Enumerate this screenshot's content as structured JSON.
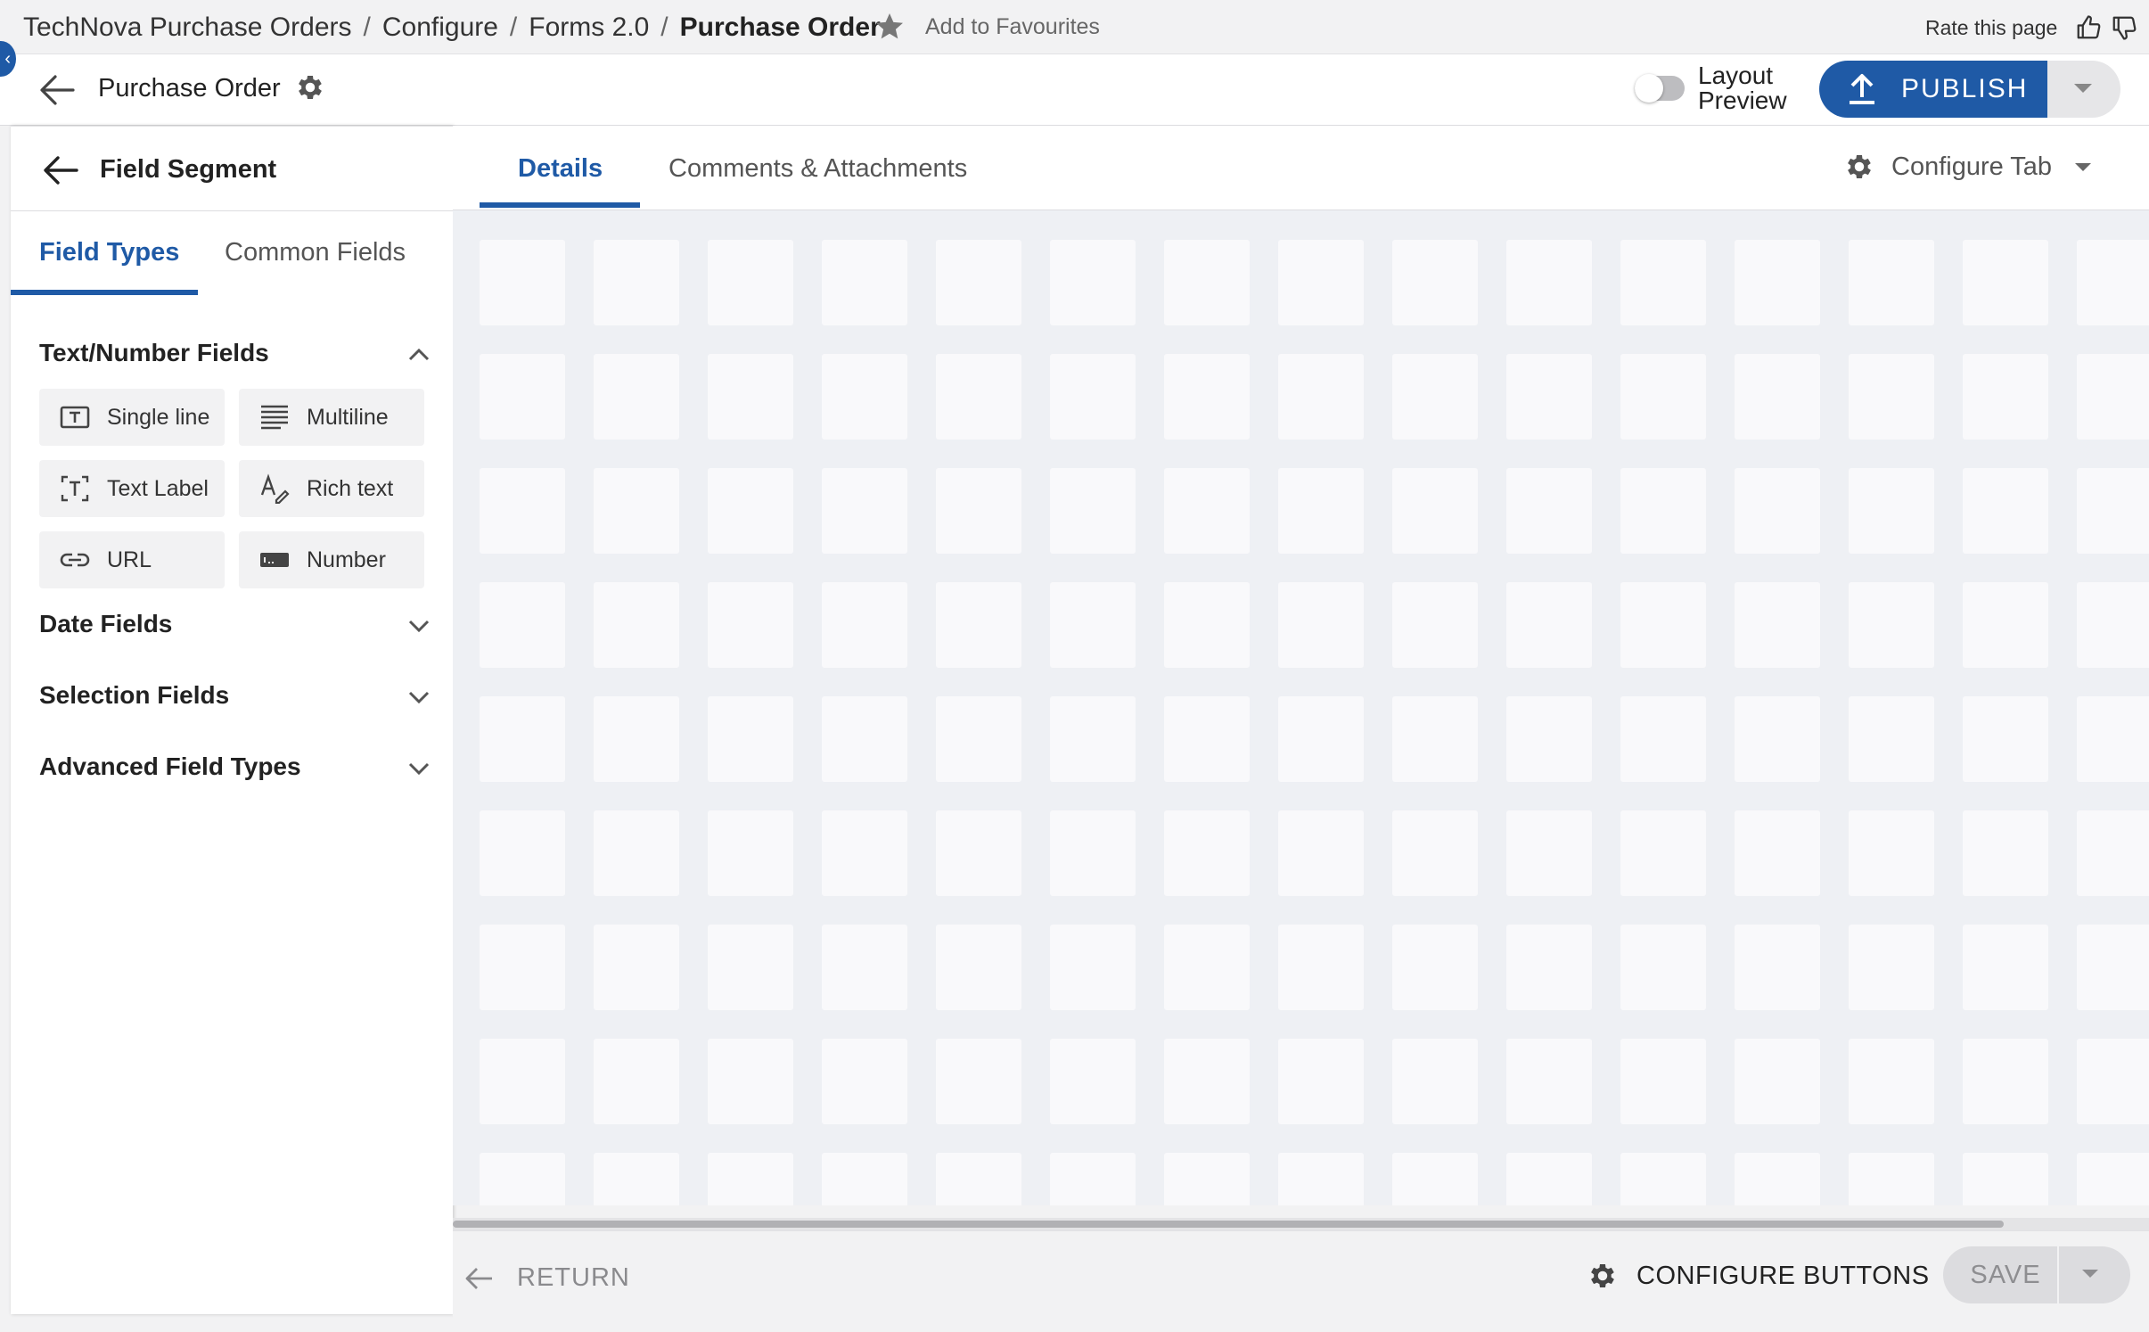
{
  "breadcrumb": {
    "items": [
      "TechNova Purchase Orders",
      "Configure",
      "Forms 2.0"
    ],
    "separator": "/",
    "current": "Purchase Order"
  },
  "favourites": {
    "label": "Add to Favourites",
    "icon": "star-icon"
  },
  "rating": {
    "label": "Rate this page",
    "icons": [
      "thumbs-up-icon",
      "thumbs-down-icon"
    ]
  },
  "header": {
    "title": "Purchase Order",
    "layout_preview": {
      "line1": "Layout",
      "line2": "Preview",
      "on": false
    },
    "publish_label": "PUBLISH"
  },
  "panel": {
    "title": "Field Segment",
    "tabs": [
      {
        "label": "Field Types",
        "active": true
      },
      {
        "label": "Common Fields",
        "active": false
      }
    ],
    "sections": [
      {
        "title": "Text/Number Fields",
        "expanded": true,
        "fields": [
          {
            "label": "Single line",
            "icon": "single-line-icon"
          },
          {
            "label": "Multiline",
            "icon": "multiline-icon"
          },
          {
            "label": "Text Label",
            "icon": "text-label-icon"
          },
          {
            "label": "Rich text",
            "icon": "rich-text-icon"
          },
          {
            "label": "URL",
            "icon": "link-icon"
          },
          {
            "label": "Number",
            "icon": "number-icon"
          }
        ]
      },
      {
        "title": "Date Fields",
        "expanded": false
      },
      {
        "title": "Selection Fields",
        "expanded": false
      },
      {
        "title": "Advanced Field Types",
        "expanded": false
      }
    ]
  },
  "main": {
    "tabs": [
      {
        "label": "Details",
        "active": true
      },
      {
        "label": "Comments & Attachments",
        "active": false
      }
    ],
    "configure_tab_label": "Configure Tab"
  },
  "footer": {
    "return_label": "RETURN",
    "configure_buttons_label": "CONFIGURE BUTTONS",
    "save_label": "SAVE"
  },
  "colors": {
    "accent": "#1f5aa6",
    "canvas_bg": "#eef0f4",
    "grid_cell": "#f9f9fb"
  }
}
